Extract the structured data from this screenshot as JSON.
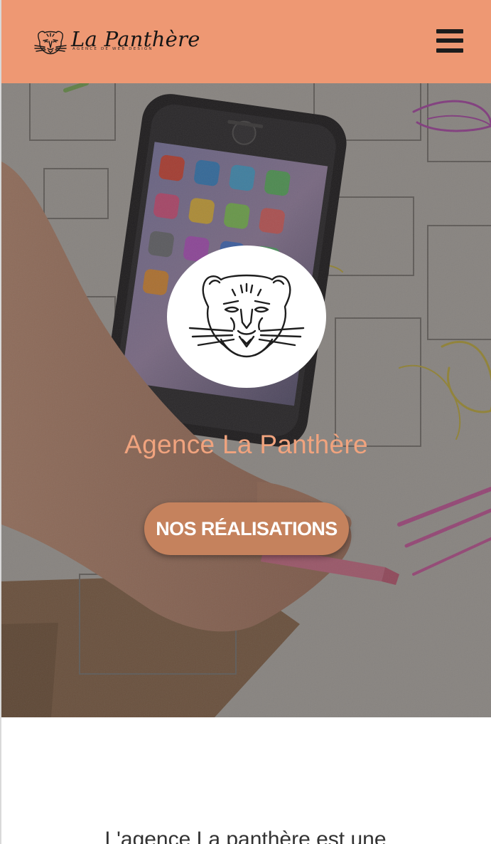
{
  "header": {
    "brand_name": "La Panthère",
    "brand_tagline": "AGENCE DE WEB DESIGN",
    "menu_icon": "hamburger-menu-icon",
    "background_color": "#ee9873"
  },
  "hero": {
    "logo_icon": "panther-head-icon",
    "title": "Agence La Panthère",
    "cta_label": "NOS RÉALISATIONS",
    "title_color": "#f0a37e",
    "cta_color": "#c5825d"
  },
  "intro": {
    "text": "L'agence La panthère est une"
  }
}
